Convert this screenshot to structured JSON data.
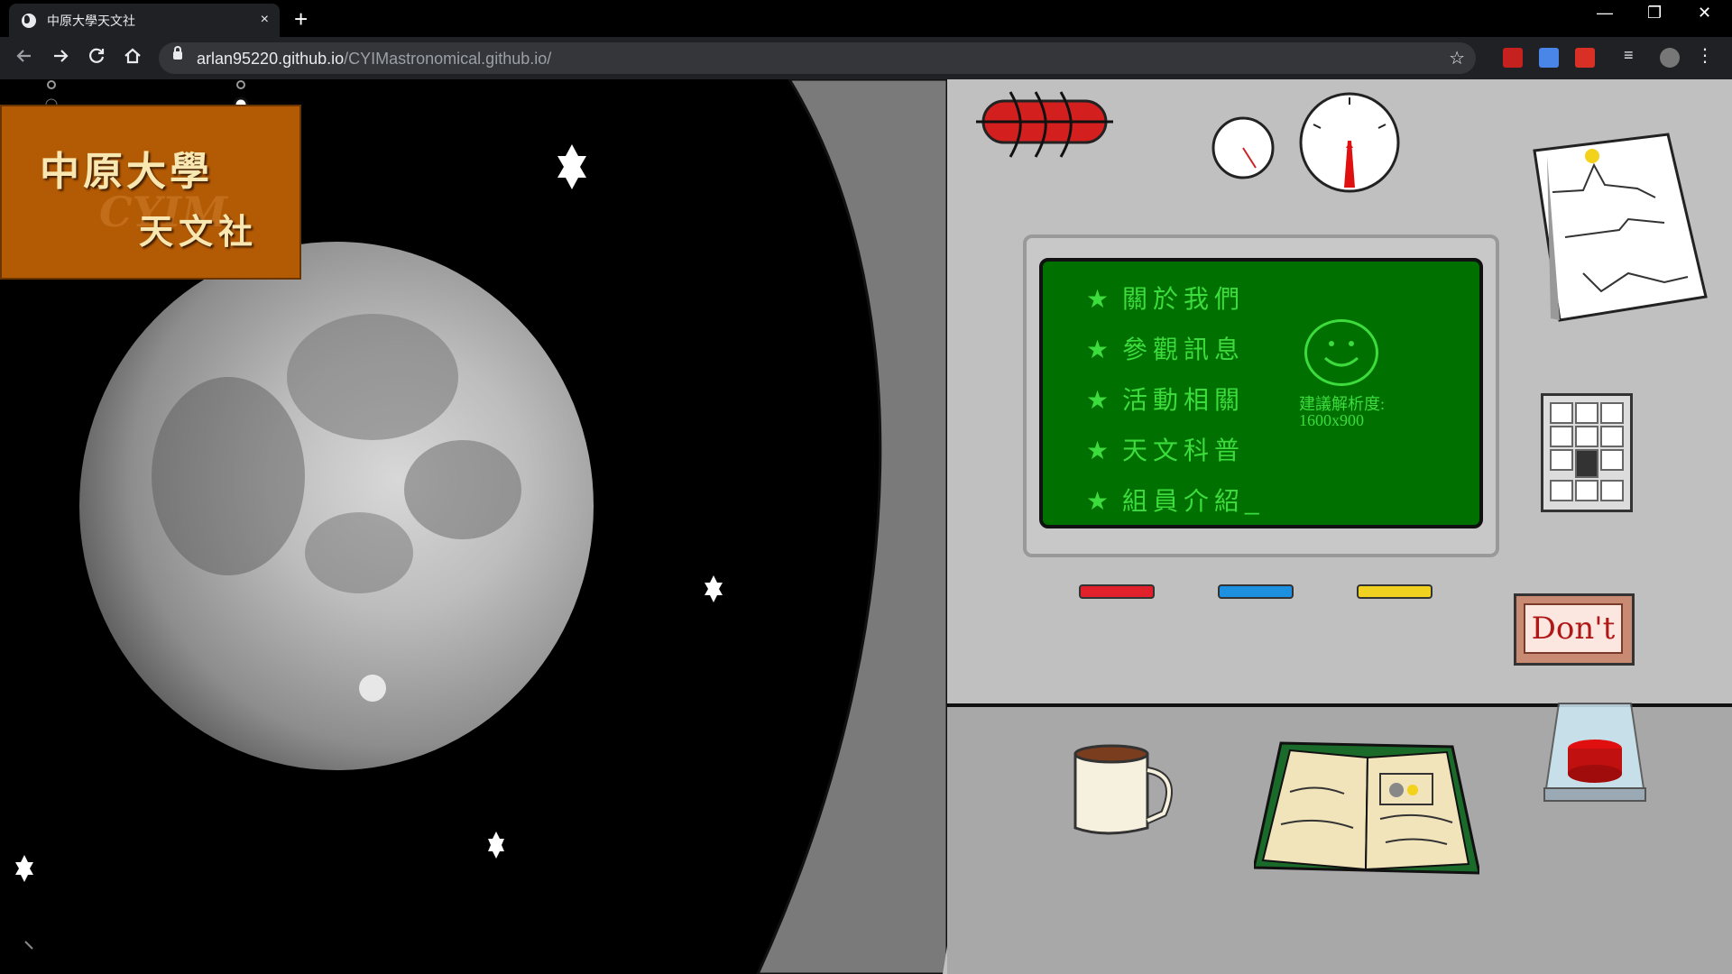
{
  "browser": {
    "tab_title": "中原大學天文社",
    "tab_close": "×",
    "new_tab": "+",
    "window_controls": [
      "—",
      "❐",
      "✕"
    ],
    "url_host": "arlan95220.github.io",
    "url_path": "/CYIMastronomical.github.io/",
    "nav_icons": [
      "back-icon",
      "forward-icon",
      "reload-icon",
      "home-icon"
    ],
    "extensions": [
      "pdf-extension-icon",
      "translate-extension-icon",
      "media-extension-icon",
      "playlist-icon",
      "profile-avatar",
      "menu-icon"
    ]
  },
  "logo": {
    "line1": "中原大學",
    "line2": "天文社",
    "watermark": "CYIM"
  },
  "screen": {
    "star_glyph": "★",
    "menu": [
      {
        "label": "關於我們"
      },
      {
        "label": "參觀訊息"
      },
      {
        "label": "活動相關"
      },
      {
        "label": "天文科普"
      },
      {
        "label": "組員介紹_"
      }
    ],
    "resolution_label": "建議解析度:",
    "resolution_value": "1600x900"
  },
  "sign": {
    "text": "Don't"
  },
  "colors": {
    "screen_bg": "#007000",
    "screen_text": "#3ddc3d",
    "logo_bg": "#b35a05",
    "panel": "#c0c0c0",
    "led_red": "#e0202a",
    "led_blue": "#1e90e0",
    "led_yellow": "#f0d020"
  }
}
